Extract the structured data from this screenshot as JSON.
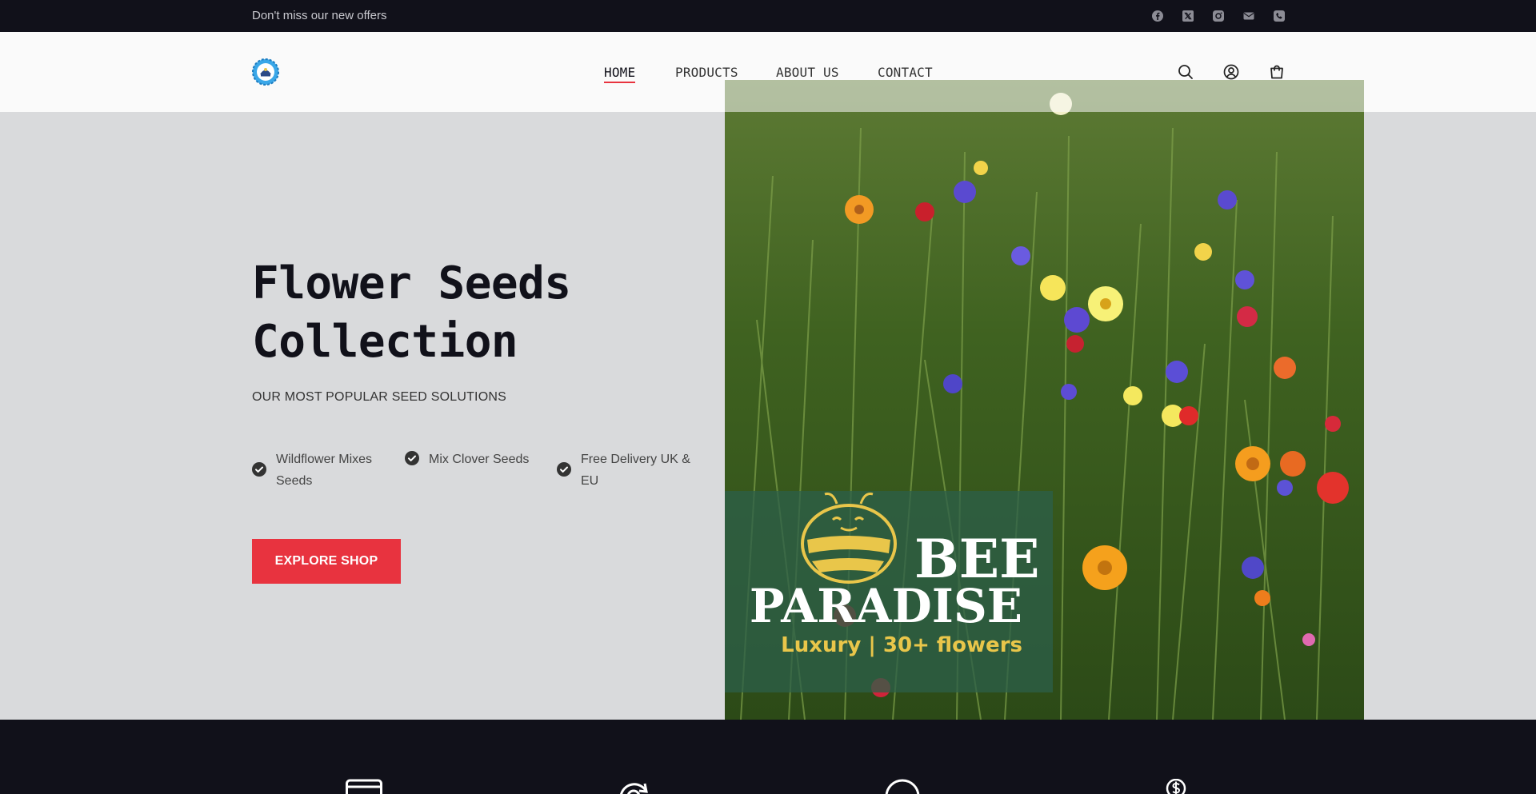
{
  "topbar": {
    "announcement": "Don't miss our new offers",
    "social_icons": [
      "facebook-icon",
      "x-icon",
      "instagram-icon",
      "mail-icon",
      "phone-icon"
    ]
  },
  "header": {
    "logo_icon": "logo-icon",
    "nav": [
      {
        "label": "HOME",
        "active": true
      },
      {
        "label": "PRODUCTS",
        "active": false
      },
      {
        "label": "ABOUT US",
        "active": false
      },
      {
        "label": "CONTACT",
        "active": false
      }
    ],
    "icons": [
      "search-icon",
      "account-icon",
      "cart-icon"
    ]
  },
  "hero": {
    "title_line1": "Flower Seeds",
    "title_line2": "Collection",
    "subtitle": "OUR MOST POPULAR SEED SOLUTIONS",
    "features": [
      {
        "line1": "Wildflower Mixes",
        "line2": "Seeds"
      },
      {
        "line1": "Mix Clover Seeds",
        "line2": ""
      },
      {
        "line1": "Free Delivery UK &",
        "line2": "EU"
      }
    ],
    "cta_label": "EXPLORE SHOP",
    "image": {
      "brand_line1": "BEE",
      "brand_line2": "PARADISE",
      "tagline": "Luxury | 30+ flowers"
    }
  },
  "colors": {
    "accent": "#e8333f",
    "dark": "#11111a",
    "hero_bg": "#d9dadc",
    "tagline_yellow": "#e9c64a"
  },
  "footer_icons": [
    "card-icon",
    "refresh-icon",
    "chat-icon",
    "dollar-icon"
  ]
}
